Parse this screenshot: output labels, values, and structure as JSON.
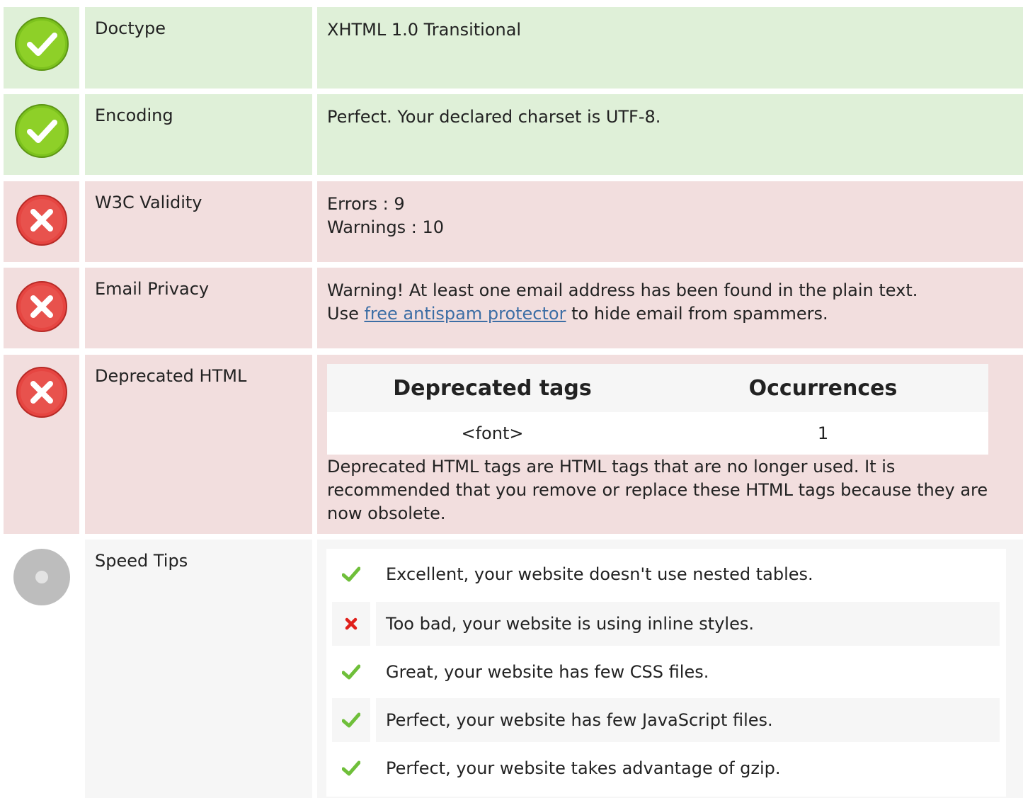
{
  "rows": [
    {
      "label": "Doctype",
      "status": "pass",
      "value": "XHTML 1.0 Transitional"
    },
    {
      "label": "Encoding",
      "status": "pass",
      "value": "Perfect. Your declared charset is UTF-8."
    },
    {
      "label": "W3C Validity",
      "status": "fail",
      "line1": "Errors : 9",
      "line2": "Warnings : 10"
    },
    {
      "label": "Email Privacy",
      "status": "fail",
      "line1": "Warning! At least one email address has been found in the plain text.",
      "prefix": "Use ",
      "link": "free antispam protector",
      "suffix": " to hide email from spammers."
    },
    {
      "label": "Deprecated HTML",
      "status": "fail",
      "table_headers": [
        "Deprecated tags",
        "Occurrences"
      ],
      "table_rows": [
        [
          "<font>",
          "1"
        ]
      ],
      "note": "Deprecated HTML tags are HTML tags that are no longer used. It is recommended that you remove or replace these HTML tags because they are now obsolete."
    },
    {
      "label": "Speed Tips",
      "status": "neutral",
      "tips": [
        {
          "ok": true,
          "text": "Excellent, your website doesn't use nested tables."
        },
        {
          "ok": false,
          "text": "Too bad, your website is using inline styles."
        },
        {
          "ok": true,
          "text": "Great, your website has few CSS files."
        },
        {
          "ok": true,
          "text": "Perfect, your website has few JavaScript files."
        },
        {
          "ok": true,
          "text": "Perfect, your website takes advantage of gzip."
        }
      ]
    }
  ],
  "colors": {
    "pass_bg": "#dff0d8",
    "fail_bg": "#f2dede",
    "neutral_bg": "#f6f6f6",
    "link": "#3d6ea5",
    "check": "#6fbf3a",
    "cross": "#e0201b"
  }
}
